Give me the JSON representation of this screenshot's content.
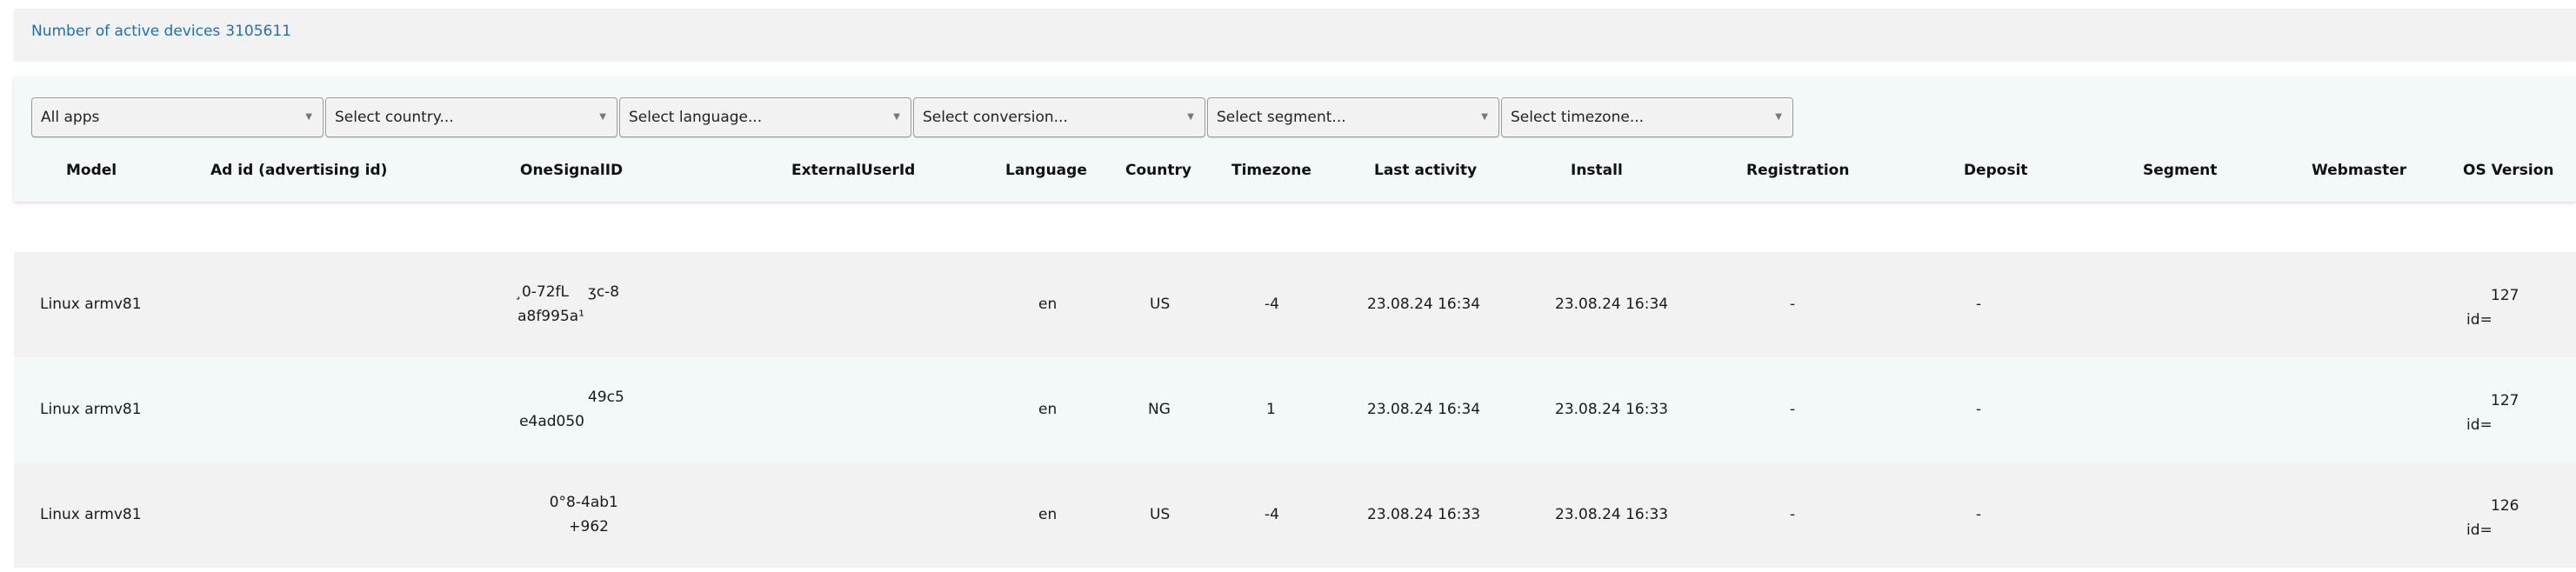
{
  "header": {
    "active_devices_label": "Number of active devices",
    "active_devices_count": "3105611"
  },
  "filters": {
    "app": "All apps",
    "country": "Select country...",
    "language": "Select language...",
    "conversion": "Select conversion...",
    "segment": "Select segment...",
    "timezone": "Select timezone..."
  },
  "table": {
    "columns": [
      "Model",
      "Ad id (advertising id)",
      "OneSignalID",
      "ExternalUserId",
      "Language",
      "Country",
      "Timezone",
      "Last activity",
      "Install",
      "Registration",
      "Deposit",
      "Segment",
      "Webmaster",
      "OS Version"
    ],
    "rows": [
      {
        "model": "Linux armv81",
        "onesignal_line1": "¸0-72fL                                        ",
        "onesignal_a": "¸0-72fL",
        "onesignal_b": "ʒc-8",
        "onesignal_c": "a8f995a¹",
        "language": "en",
        "country": "US",
        "timezone": "-4",
        "last_activity": "23.08.24 16:34",
        "install": "23.08.24 16:34",
        "registration": "-",
        "deposit": "-",
        "os_line1": "127",
        "os_line2": "id="
      },
      {
        "model": "Linux armv81",
        "onesignal_a": "",
        "onesignal_b": "49c5",
        "onesignal_c": "e4ad050",
        "language": "en",
        "country": "NG",
        "timezone": "1",
        "last_activity": "23.08.24 16:34",
        "install": "23.08.24 16:33",
        "registration": "-",
        "deposit": "-",
        "os_line1": "127",
        "os_line2": "id="
      },
      {
        "model": "Linux armv81",
        "onesignal_a": "0°8-",
        "onesignal_b": "4ab1",
        "onesignal_c": "+962",
        "language": "en",
        "country": "US",
        "timezone": "-4",
        "last_activity": "23.08.24 16:33",
        "install": "23.08.24 16:33",
        "registration": "-",
        "deposit": "-",
        "os_line1": "126",
        "os_line2": "id="
      }
    ]
  },
  "colors": {
    "accent_link": "#1f6fb5",
    "row_odd": "#f2f2f2",
    "row_even": "#f3f8f9",
    "panel": "#f3f8f9"
  }
}
